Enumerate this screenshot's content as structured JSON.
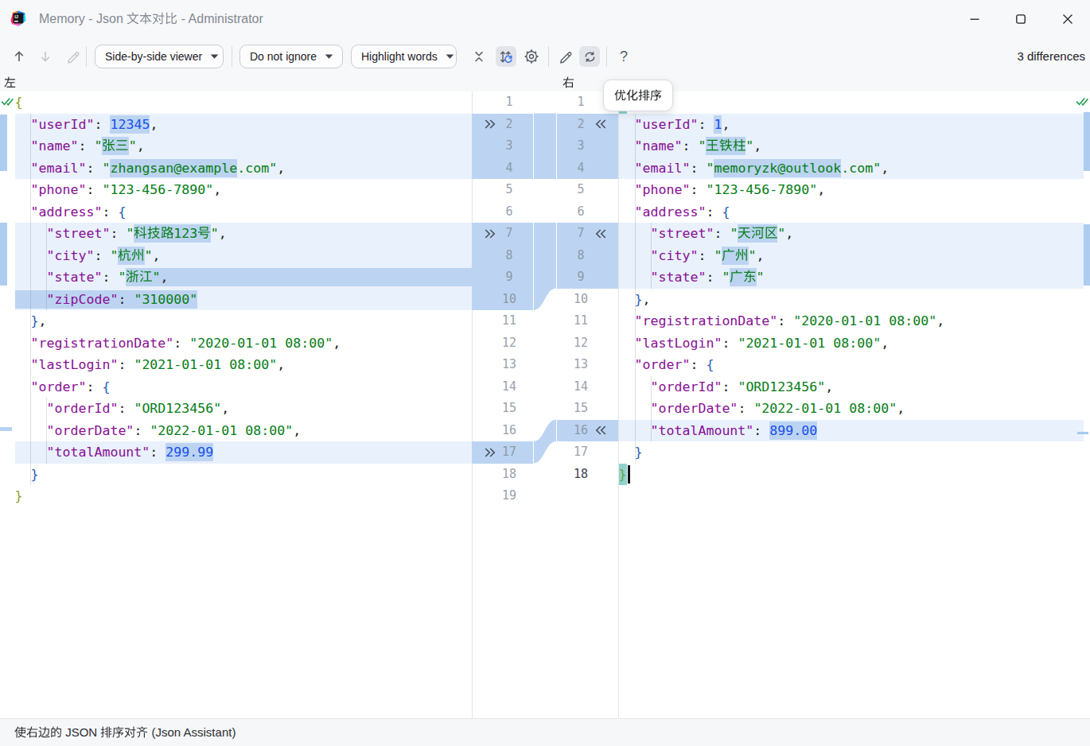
{
  "window": {
    "title": "Memory - Json 文本对比 - Administrator",
    "icon": "intellij-idea-logo",
    "controls": [
      "minimize",
      "maximize",
      "close"
    ]
  },
  "toolbar": {
    "icons": [
      {
        "name": "prev-difference-icon",
        "enabled": true
      },
      {
        "name": "next-difference-icon",
        "enabled": false
      },
      {
        "name": "edit-pencil-icon",
        "enabled": false
      },
      {
        "name": "collapse-unchanged-icon",
        "enabled": true
      },
      {
        "name": "sync-scroll-icon",
        "enabled": true,
        "toggled": true
      },
      {
        "name": "settings-gear-icon",
        "enabled": true
      },
      {
        "name": "edit-pencil-icon-2",
        "enabled": true
      },
      {
        "name": "optimize-sort-refresh-icon",
        "enabled": true,
        "hovered": true
      },
      {
        "name": "help-icon",
        "enabled": true
      }
    ],
    "dropdowns": [
      {
        "label": "Side-by-side viewer"
      },
      {
        "label": "Do not ignore"
      },
      {
        "label": "Highlight words"
      }
    ],
    "differences_label": "3 differences"
  },
  "tooltip": {
    "text": "优化排序"
  },
  "statusbar": {
    "text": "使右边的 JSON 排序对齐 (Json Assistant)"
  },
  "panes": {
    "left": {
      "header": "左",
      "lines": [
        {
          "tokens": [
            [
              "{",
              "b0"
            ]
          ]
        },
        {
          "changed": true,
          "tokens": [
            [
              "  ",
              "pln"
            ],
            [
              "\"userId\"",
              "key"
            ],
            [
              ":",
              "pun"
            ],
            [
              " ",
              "pln"
            ],
            [
              "12345",
              "num",
              1
            ],
            [
              ",",
              "pun"
            ]
          ]
        },
        {
          "changed": true,
          "tokens": [
            [
              "  ",
              "pln"
            ],
            [
              "\"name\"",
              "key"
            ],
            [
              ":",
              "pun"
            ],
            [
              " ",
              "pln"
            ],
            [
              "\"",
              "str"
            ],
            [
              "张三",
              "str",
              1
            ],
            [
              "\"",
              "str"
            ],
            [
              ",",
              "pun"
            ]
          ]
        },
        {
          "changed": true,
          "tokens": [
            [
              "  ",
              "pln"
            ],
            [
              "\"email\"",
              "key"
            ],
            [
              ":",
              "pun"
            ],
            [
              " ",
              "pln"
            ],
            [
              "\"",
              "str"
            ],
            [
              "zhangsan@example",
              "str",
              1
            ],
            [
              ".com\"",
              "str"
            ],
            [
              ",",
              "pun"
            ]
          ]
        },
        {
          "tokens": [
            [
              "  ",
              "pln"
            ],
            [
              "\"phone\"",
              "key"
            ],
            [
              ":",
              "pun"
            ],
            [
              " ",
              "pln"
            ],
            [
              "\"123-456-7890\"",
              "str"
            ],
            [
              ",",
              "pun"
            ]
          ]
        },
        {
          "tokens": [
            [
              "  ",
              "pln"
            ],
            [
              "\"address\"",
              "key"
            ],
            [
              ":",
              "pun"
            ],
            [
              " ",
              "pln"
            ],
            [
              "{",
              "b1"
            ]
          ]
        },
        {
          "changed": true,
          "tokens": [
            [
              "    ",
              "pln"
            ],
            [
              "\"street\"",
              "key"
            ],
            [
              ":",
              "pun"
            ],
            [
              " ",
              "pln"
            ],
            [
              "\"",
              "str"
            ],
            [
              "科技路123号",
              "str",
              1
            ],
            [
              "\"",
              "str"
            ],
            [
              ",",
              "pun"
            ]
          ]
        },
        {
          "changed": true,
          "tokens": [
            [
              "    ",
              "pln"
            ],
            [
              "\"city\"",
              "key"
            ],
            [
              ":",
              "pun"
            ],
            [
              " ",
              "pln"
            ],
            [
              "\"",
              "str"
            ],
            [
              "杭州",
              "str",
              1
            ],
            [
              "\"",
              "str"
            ],
            [
              ",",
              "pun"
            ]
          ]
        },
        {
          "changed": true,
          "tail_hl": true,
          "tokens": [
            [
              "    ",
              "pln"
            ],
            [
              "\"state\"",
              "key"
            ],
            [
              ":",
              "pun"
            ],
            [
              " ",
              "pln"
            ],
            [
              "\"",
              "str"
            ],
            [
              "浙江",
              "str",
              1
            ],
            [
              "\"",
              "str",
              1
            ],
            [
              ",",
              "pun",
              1
            ]
          ]
        },
        {
          "changed": true,
          "tokens": [
            [
              "    ",
              "pln",
              1
            ],
            [
              "\"zipCode\"",
              "key",
              1
            ],
            [
              ":",
              "pun",
              1
            ],
            [
              " ",
              "pln",
              1
            ],
            [
              "\"310000\"",
              "str",
              1
            ]
          ]
        },
        {
          "tokens": [
            [
              "  ",
              "pln"
            ],
            [
              "}",
              "b1"
            ],
            [
              ",",
              "pun"
            ]
          ]
        },
        {
          "tokens": [
            [
              "  ",
              "pln"
            ],
            [
              "\"registrationDate\"",
              "key"
            ],
            [
              ":",
              "pun"
            ],
            [
              " ",
              "pln"
            ],
            [
              "\"2020-01-01 08:00\"",
              "str"
            ],
            [
              ",",
              "pun"
            ]
          ]
        },
        {
          "tokens": [
            [
              "  ",
              "pln"
            ],
            [
              "\"lastLogin\"",
              "key"
            ],
            [
              ":",
              "pun"
            ],
            [
              " ",
              "pln"
            ],
            [
              "\"2021-01-01 08:00\"",
              "str"
            ],
            [
              ",",
              "pun"
            ]
          ]
        },
        {
          "tokens": [
            [
              "  ",
              "pln"
            ],
            [
              "\"order\"",
              "key"
            ],
            [
              ":",
              "pun"
            ],
            [
              " ",
              "pln"
            ],
            [
              "{",
              "b1"
            ]
          ]
        },
        {
          "tokens": [
            [
              "    ",
              "pln"
            ],
            [
              "\"orderId\"",
              "key"
            ],
            [
              ":",
              "pun"
            ],
            [
              " ",
              "pln"
            ],
            [
              "\"ORD123456\"",
              "str"
            ],
            [
              ",",
              "pun"
            ]
          ]
        },
        {
          "tokens": [
            [
              "    ",
              "pln"
            ],
            [
              "\"orderDate\"",
              "key"
            ],
            [
              ":",
              "pun"
            ],
            [
              " ",
              "pln"
            ],
            [
              "\"2022-01-01 08:00\"",
              "str"
            ],
            [
              ",",
              "pun"
            ]
          ]
        },
        {
          "changed": true,
          "tokens": [
            [
              "    ",
              "pln"
            ],
            [
              "\"totalAmount\"",
              "key"
            ],
            [
              ":",
              "pun"
            ],
            [
              " ",
              "pln"
            ],
            [
              "299.99",
              "num",
              1
            ]
          ]
        },
        {
          "tokens": [
            [
              "  ",
              "pln"
            ],
            [
              "}",
              "b1"
            ]
          ]
        },
        {
          "tokens": [
            [
              "}",
              "b0"
            ]
          ]
        }
      ]
    },
    "right": {
      "header": "右",
      "lines": [
        {
          "tokens": [
            [
              "{",
              "bm"
            ]
          ]
        },
        {
          "changed": true,
          "tokens": [
            [
              "  ",
              "pln"
            ],
            [
              "\"userId\"",
              "key"
            ],
            [
              ":",
              "pun"
            ],
            [
              " ",
              "pln"
            ],
            [
              "1",
              "num",
              1
            ],
            [
              ",",
              "pun"
            ]
          ]
        },
        {
          "changed": true,
          "tokens": [
            [
              "  ",
              "pln"
            ],
            [
              "\"name\"",
              "key"
            ],
            [
              ":",
              "pun"
            ],
            [
              " ",
              "pln"
            ],
            [
              "\"",
              "str"
            ],
            [
              "王铁柱",
              "str",
              1
            ],
            [
              "\"",
              "str"
            ],
            [
              ",",
              "pun"
            ]
          ]
        },
        {
          "changed": true,
          "tokens": [
            [
              "  ",
              "pln"
            ],
            [
              "\"email\"",
              "key"
            ],
            [
              ":",
              "pun"
            ],
            [
              " ",
              "pln"
            ],
            [
              "\"",
              "str"
            ],
            [
              "memoryzk@outlook",
              "str",
              1
            ],
            [
              ".com\"",
              "str"
            ],
            [
              ",",
              "pun"
            ]
          ]
        },
        {
          "tokens": [
            [
              "  ",
              "pln"
            ],
            [
              "\"phone\"",
              "key"
            ],
            [
              ":",
              "pun"
            ],
            [
              " ",
              "pln"
            ],
            [
              "\"123-456-7890\"",
              "str"
            ],
            [
              ",",
              "pun"
            ]
          ]
        },
        {
          "tokens": [
            [
              "  ",
              "pln"
            ],
            [
              "\"address\"",
              "key"
            ],
            [
              ":",
              "pun"
            ],
            [
              " ",
              "pln"
            ],
            [
              "{",
              "b1"
            ]
          ]
        },
        {
          "changed": true,
          "tokens": [
            [
              "    ",
              "pln"
            ],
            [
              "\"street\"",
              "key"
            ],
            [
              ":",
              "pun"
            ],
            [
              " ",
              "pln"
            ],
            [
              "\"",
              "str"
            ],
            [
              "天河区",
              "str",
              1
            ],
            [
              "\"",
              "str"
            ],
            [
              ",",
              "pun"
            ]
          ]
        },
        {
          "changed": true,
          "tokens": [
            [
              "    ",
              "pln"
            ],
            [
              "\"city\"",
              "key"
            ],
            [
              ":",
              "pun"
            ],
            [
              " ",
              "pln"
            ],
            [
              "\"",
              "str"
            ],
            [
              "广州",
              "str",
              1
            ],
            [
              "\"",
              "str"
            ],
            [
              ",",
              "pun"
            ]
          ]
        },
        {
          "changed": true,
          "tokens": [
            [
              "    ",
              "pln"
            ],
            [
              "\"state\"",
              "key"
            ],
            [
              ":",
              "pun"
            ],
            [
              " ",
              "pln"
            ],
            [
              "\"",
              "str"
            ],
            [
              "广东",
              "str",
              1
            ],
            [
              "\"",
              "str"
            ]
          ]
        },
        {
          "tokens": [
            [
              "  ",
              "pln"
            ],
            [
              "}",
              "b1"
            ],
            [
              ",",
              "pun"
            ]
          ]
        },
        {
          "tokens": [
            [
              "  ",
              "pln"
            ],
            [
              "\"registrationDate\"",
              "key"
            ],
            [
              ":",
              "pun"
            ],
            [
              " ",
              "pln"
            ],
            [
              "\"2020-01-01 08:00\"",
              "str"
            ],
            [
              ",",
              "pun"
            ]
          ]
        },
        {
          "tokens": [
            [
              "  ",
              "pln"
            ],
            [
              "\"lastLogin\"",
              "key"
            ],
            [
              ":",
              "pun"
            ],
            [
              " ",
              "pln"
            ],
            [
              "\"2021-01-01 08:00\"",
              "str"
            ],
            [
              ",",
              "pun"
            ]
          ]
        },
        {
          "tokens": [
            [
              "  ",
              "pln"
            ],
            [
              "\"order\"",
              "key"
            ],
            [
              ":",
              "pun"
            ],
            [
              " ",
              "pln"
            ],
            [
              "{",
              "b1"
            ]
          ]
        },
        {
          "tokens": [
            [
              "    ",
              "pln"
            ],
            [
              "\"orderId\"",
              "key"
            ],
            [
              ":",
              "pun"
            ],
            [
              " ",
              "pln"
            ],
            [
              "\"ORD123456\"",
              "str"
            ],
            [
              ",",
              "pun"
            ]
          ]
        },
        {
          "tokens": [
            [
              "    ",
              "pln"
            ],
            [
              "\"orderDate\"",
              "key"
            ],
            [
              ":",
              "pun"
            ],
            [
              " ",
              "pln"
            ],
            [
              "\"2022-01-01 08:00\"",
              "str"
            ],
            [
              ",",
              "pun"
            ]
          ]
        },
        {
          "changed": true,
          "tokens": [
            [
              "    ",
              "pln"
            ],
            [
              "\"totalAmount\"",
              "key"
            ],
            [
              ":",
              "pun"
            ],
            [
              " ",
              "pln"
            ],
            [
              "899.00",
              "num",
              1
            ]
          ]
        },
        {
          "tokens": [
            [
              "  ",
              "pln"
            ],
            [
              "}",
              "b1"
            ]
          ]
        },
        {
          "cursor": true,
          "current": true,
          "tokens": [
            [
              "}",
              "bm"
            ]
          ]
        }
      ]
    }
  },
  "diff": {
    "chunks": [
      {
        "left": [
          2,
          4
        ],
        "right": [
          2,
          4
        ]
      },
      {
        "left": [
          7,
          10
        ],
        "right": [
          7,
          9
        ]
      },
      {
        "left": [
          17,
          17
        ],
        "right": [
          16,
          16
        ]
      }
    ]
  },
  "colors": {
    "chunk_blue": "#bcd4f2",
    "changed_line_bg": "#e9f1fc",
    "word_highlight": "#bcd4f2",
    "brace_match_bg": "#90d3cc",
    "json_key": "#871094",
    "json_string": "#067d17",
    "json_number": "#1750eb",
    "check_green": "#1f9e50",
    "accent_blue": "#3574f0"
  }
}
